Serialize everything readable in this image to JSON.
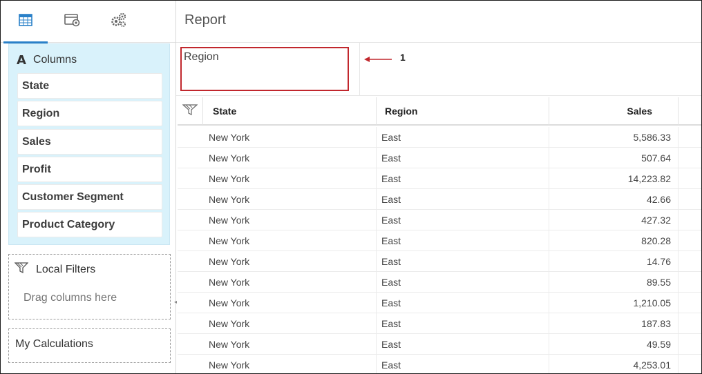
{
  "left_panel": {
    "tabs": [
      {
        "name": "table-view-tab",
        "icon": "table-icon",
        "active": true
      },
      {
        "name": "properties-tab",
        "icon": "window-gear-icon",
        "active": false
      },
      {
        "name": "settings-tab",
        "icon": "gears-icon",
        "active": false
      }
    ],
    "columns": {
      "header_icon_glyph": "A",
      "header_label": "Columns",
      "items": [
        "State",
        "Region",
        "Sales",
        "Profit",
        "Customer Segment",
        "Product Category"
      ]
    },
    "local_filters": {
      "label": "Local Filters",
      "placeholder": "Drag columns here"
    },
    "my_calculations": {
      "label": "My Calculations"
    }
  },
  "report": {
    "title": "Report",
    "dropzone_value": "Region",
    "callout_number": "1",
    "accent_color": "#c1272d",
    "tab_accent_color": "#2a80c8"
  },
  "grid": {
    "headers": {
      "state": "State",
      "region": "Region",
      "sales": "Sales"
    },
    "rows": [
      {
        "state": "New York",
        "region": "East",
        "sales": "5,586.33"
      },
      {
        "state": "New York",
        "region": "East",
        "sales": "507.64"
      },
      {
        "state": "New York",
        "region": "East",
        "sales": "14,223.82"
      },
      {
        "state": "New York",
        "region": "East",
        "sales": "42.66"
      },
      {
        "state": "New York",
        "region": "East",
        "sales": "427.32"
      },
      {
        "state": "New York",
        "region": "East",
        "sales": "820.28"
      },
      {
        "state": "New York",
        "region": "East",
        "sales": "14.76"
      },
      {
        "state": "New York",
        "region": "East",
        "sales": "89.55"
      },
      {
        "state": "New York",
        "region": "East",
        "sales": "1,210.05"
      },
      {
        "state": "New York",
        "region": "East",
        "sales": "187.83"
      },
      {
        "state": "New York",
        "region": "East",
        "sales": "49.59"
      },
      {
        "state": "New York",
        "region": "East",
        "sales": "4,253.01"
      }
    ]
  }
}
